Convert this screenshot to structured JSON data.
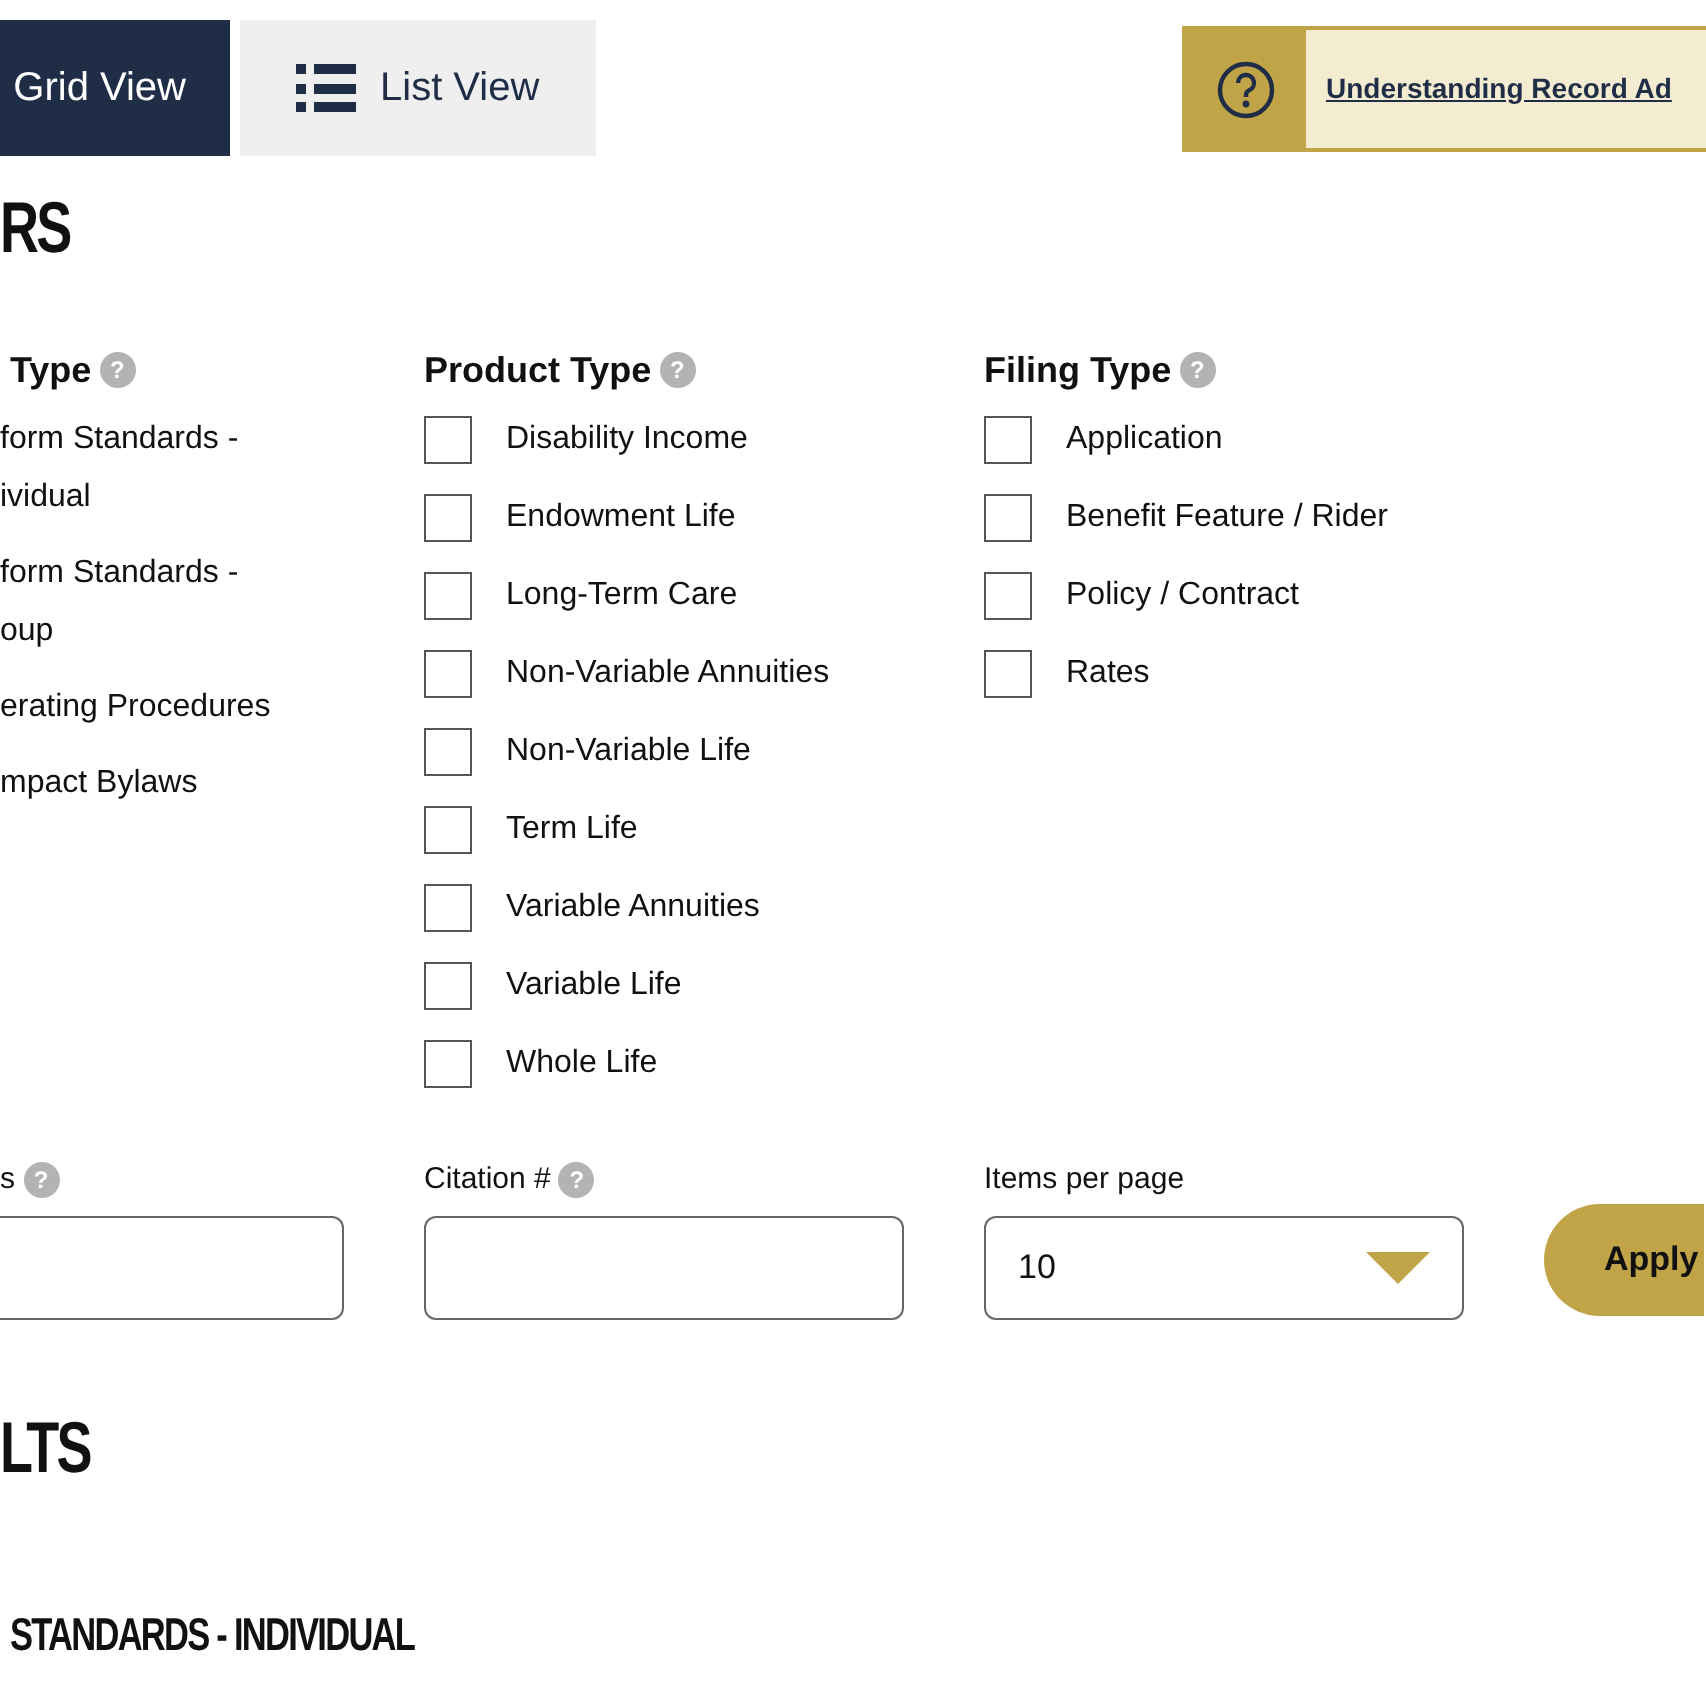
{
  "view_toggle": [
    {
      "label": "Grid View",
      "selected": true,
      "kind": "grid"
    },
    {
      "label": "List View",
      "selected": false,
      "kind": "list"
    }
  ],
  "help_banner": {
    "link": "Understanding Record Ad"
  },
  "filters_heading": "RS",
  "filter_groups": [
    {
      "title": "Type",
      "help": "?",
      "options": [
        {
          "label": "form Standards - ividual"
        },
        {
          "label": "form Standards - oup"
        },
        {
          "label": "erating Procedures"
        },
        {
          "label": "mpact Bylaws"
        }
      ]
    },
    {
      "title": "Product Type",
      "help": "?",
      "options": [
        {
          "label": "Disability Income",
          "checked": false
        },
        {
          "label": "Endowment Life",
          "checked": false
        },
        {
          "label": "Long-Term Care",
          "checked": false
        },
        {
          "label": "Non-Variable Annuities",
          "checked": false
        },
        {
          "label": "Non-Variable Life",
          "checked": false
        },
        {
          "label": "Term Life",
          "checked": false
        },
        {
          "label": "Variable Annuities",
          "checked": false
        },
        {
          "label": "Variable Life",
          "checked": false
        },
        {
          "label": "Whole Life",
          "checked": false
        }
      ]
    },
    {
      "title": "Filing Type",
      "help": "?",
      "options": [
        {
          "label": "Application",
          "checked": false
        },
        {
          "label": "Benefit Feature / Rider",
          "checked": false
        },
        {
          "label": "Policy / Contract",
          "checked": false
        },
        {
          "label": "Rates",
          "checked": false
        }
      ]
    }
  ],
  "fields": [
    {
      "label": "s",
      "help": "?",
      "kind": "text"
    },
    {
      "label": "Citation #",
      "help": "?",
      "kind": "text"
    },
    {
      "label": "Items per page",
      "value": "10",
      "kind": "select"
    }
  ],
  "apply_button": "Apply",
  "results_heading": "LTS",
  "results_subheading": "STANDARDS - INDIVIDUAL"
}
